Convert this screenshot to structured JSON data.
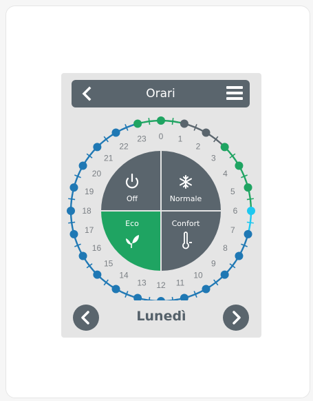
{
  "header": {
    "title": "Orari"
  },
  "day": {
    "label": "Lunedì"
  },
  "modes": {
    "off": "Off",
    "normale": "Normale",
    "eco": "Eco",
    "confort": "Confort"
  },
  "hours": [
    "0",
    "1",
    "2",
    "3",
    "4",
    "5",
    "6",
    "7",
    "8",
    "9",
    "10",
    "11",
    "12",
    "13",
    "14",
    "15",
    "16",
    "17",
    "18",
    "19",
    "20",
    "21",
    "22",
    "23"
  ],
  "colors": {
    "eco": "#1fa462",
    "off": "#5a656d",
    "normale": "#5a656d",
    "confort": "#5a656d",
    "ring_green": "#1fa462",
    "ring_blue": "#1f78b4",
    "ring_cyan": "#1ec8f0",
    "ring_gray": "#5a656d",
    "panel": "#e5e5e5"
  },
  "icons": {
    "back": "chevron-left-icon",
    "menu": "hamburger-menu-icon",
    "prev": "chevron-left-icon",
    "next": "chevron-right-icon",
    "off": "power-icon",
    "normale": "snowflake-icon",
    "eco": "leaf-icon",
    "confort": "thermometer-icon"
  }
}
